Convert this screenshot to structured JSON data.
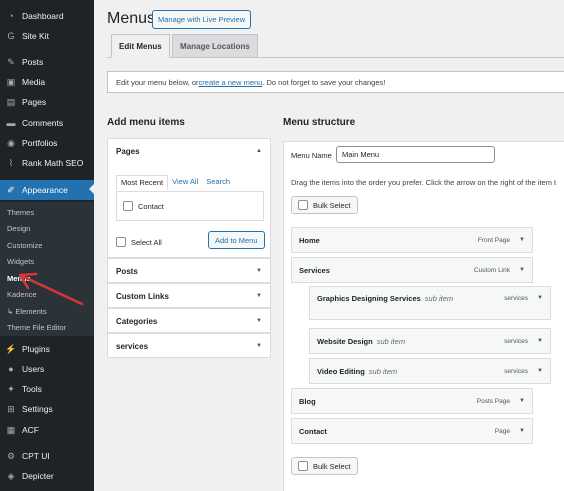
{
  "sidebar": {
    "items": [
      {
        "label": "Dashboard",
        "icon": "dashboard-icon"
      },
      {
        "label": "Site Kit",
        "icon": "sitekit-icon"
      },
      {
        "label": "Posts",
        "icon": "pin-icon"
      },
      {
        "label": "Media",
        "icon": "media-icon"
      },
      {
        "label": "Pages",
        "icon": "page-icon"
      },
      {
        "label": "Comments",
        "icon": "comment-icon"
      },
      {
        "label": "Portfolios",
        "icon": "portfolio-icon"
      },
      {
        "label": "Rank Math SEO",
        "icon": "rankmath-icon"
      },
      {
        "label": "Appearance",
        "icon": "brush-icon"
      },
      {
        "label": "Plugins",
        "icon": "plugin-icon"
      },
      {
        "label": "Users",
        "icon": "user-icon"
      },
      {
        "label": "Tools",
        "icon": "wrench-icon"
      },
      {
        "label": "Settings",
        "icon": "settings-icon"
      },
      {
        "label": "ACF",
        "icon": "acf-icon"
      },
      {
        "label": "CPT UI",
        "icon": "cpt-icon"
      },
      {
        "label": "Depicter",
        "icon": "depicter-icon"
      }
    ],
    "submenu": [
      "Themes",
      "Design",
      "Customize",
      "Widgets",
      "Menus",
      "Kadence",
      "↳ Elements",
      "Theme File Editor"
    ]
  },
  "header": {
    "title": "Menus",
    "preview_button": "Manage with Live Preview",
    "tabs": [
      "Edit Menus",
      "Manage Locations"
    ]
  },
  "notice": {
    "before": "Edit your menu below, or ",
    "link": "create a new menu",
    "after": ". Do not forget to save your changes!"
  },
  "add_items": {
    "title": "Add menu items",
    "pages": {
      "title": "Pages",
      "tabs": [
        "Most Recent",
        "View All",
        "Search"
      ],
      "items": [
        "Contact"
      ],
      "select_all": "Select All",
      "add_button": "Add to Menu"
    },
    "sections": [
      "Posts",
      "Custom Links",
      "Categories",
      "services"
    ]
  },
  "structure": {
    "title": "Menu structure",
    "menu_name_label": "Menu Name",
    "menu_name_value": "Main Menu",
    "drag_hint": "Drag the items into the order you prefer. Click the arrow on the right of the item t",
    "bulk_select": "Bulk Select",
    "items": [
      {
        "label": "Home",
        "type": "Front Page",
        "sub": ""
      },
      {
        "label": "Services",
        "type": "Custom Link",
        "sub": ""
      },
      {
        "label": "Graphics Designing Services",
        "type": "services",
        "sub": "sub item"
      },
      {
        "label": "Website Design",
        "type": "services",
        "sub": "sub item"
      },
      {
        "label": "Video Editing",
        "type": "services",
        "sub": "sub item"
      },
      {
        "label": "Blog",
        "type": "Posts Page",
        "sub": ""
      },
      {
        "label": "Contact",
        "type": "Page",
        "sub": ""
      }
    ]
  },
  "colors": {
    "sidebar_bg": "#1d2327",
    "accent": "#2271b1",
    "annotation_arrow": "#d63638"
  }
}
